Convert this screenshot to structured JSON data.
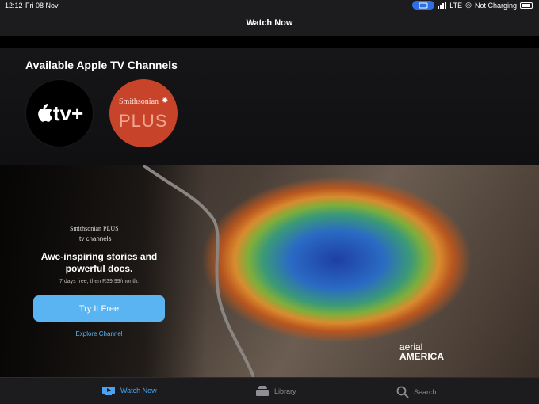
{
  "status_bar": {
    "time": "12:12",
    "date": "Fri 08 Nov",
    "network": "LTE",
    "battery_text": "Not Charging"
  },
  "nav": {
    "title": "Watch Now"
  },
  "channels": {
    "heading": "Available Apple TV Channels",
    "items": [
      {
        "label": "tv+",
        "icon": "apple-icon"
      },
      {
        "label_top": "Smithsonian",
        "label_bottom": "PLUS"
      }
    ]
  },
  "hero": {
    "brand": "Smithsonian PLUS",
    "sub": "tv channels",
    "headline": "Awe-inspiring stories and powerful docs.",
    "price": "7 days free, then R39.99/month.",
    "cta": "Try It Free",
    "secondary": "Explore Channel",
    "watermark_line1": "aerial",
    "watermark_line2": "AMERICA"
  },
  "tabs": [
    {
      "label": "Watch Now",
      "icon": "tv-icon",
      "active": true
    },
    {
      "label": "Library",
      "icon": "library-icon",
      "active": false
    },
    {
      "label": "Search",
      "icon": "search-icon",
      "active": false
    }
  ],
  "colors": {
    "accent": "#5ab4f2",
    "active_tab": "#4aa3f0",
    "smithsonian_red": "#c7442a"
  }
}
